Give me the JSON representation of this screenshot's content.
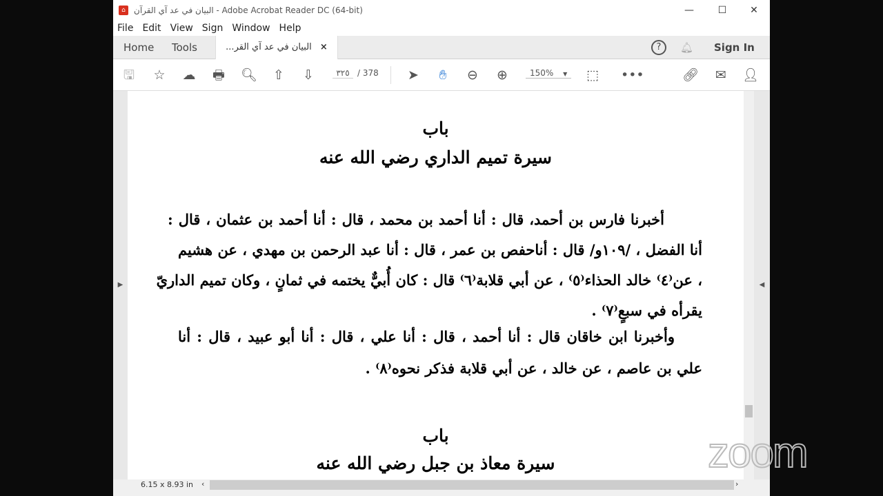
{
  "window": {
    "title": "البيان في عد آي القرآن - Adobe Acrobat Reader DC (64-bit)",
    "minimize": "—",
    "maximize": "☐",
    "close": "✕"
  },
  "menu": [
    "File",
    "Edit",
    "View",
    "Sign",
    "Window",
    "Help"
  ],
  "tabs": {
    "home": "Home",
    "tools": "Tools",
    "doc": "البيان في عد آي القر...",
    "close": "×",
    "sign_in": "Sign In"
  },
  "toolbar": {
    "page_current": "٣٢٥",
    "page_total": "/ 378",
    "zoom": "150%"
  },
  "document": {
    "heading1": "باب",
    "title1": "سيرة تميم الداري رضي الله عنه",
    "lines": [
      "أخبرنا فارس بن أحمد، قال : أنا أحمد بن محمد ، قال : أنا أحمد بن عثمان ، قال :",
      "أنا الفضل ، /١٠٩و/ قال : أناحفص بن عمر ، قال : أنا عبد الرحمن بن مهدي ، عن هشيم",
      "، عن⁽٤⁾ خالد الحذاء⁽٥⁾ ، عن أبي قلابة⁽٦⁾ قال : كان أُبيٌّ يختمه في ثمانٍ ، وكان تميم الداريّ",
      "يقرأه في سبعٍ⁽٧⁾ .",
      "وأخبرنا ابن خاقان قال : أنا أحمد ، قال : أنا علي ، قال : أنا أبو عبيد ، قال : أنا",
      "علي بن عاصم ، عن خالد ، عن أبي قلابة فذكر نحوه⁽٨⁾ ."
    ],
    "heading2": "باب",
    "title2": "سيرة معاذ بن جبل رضي الله عنه"
  },
  "status": {
    "page_size": "6.15 x 8.93 in"
  },
  "watermark": "zoom"
}
